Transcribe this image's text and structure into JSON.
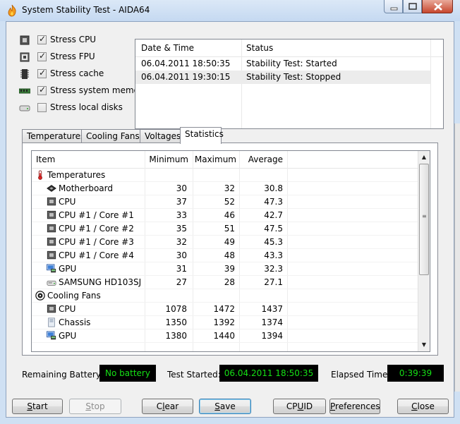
{
  "window": {
    "title": "System Stability Test - AIDA64"
  },
  "stress": [
    {
      "label": "Stress CPU",
      "checked": true,
      "icon": "cpu-icon"
    },
    {
      "label": "Stress FPU",
      "checked": true,
      "icon": "fpu-icon"
    },
    {
      "label": "Stress cache",
      "checked": true,
      "icon": "cache-icon"
    },
    {
      "label": "Stress system memory",
      "checked": true,
      "icon": "memory-icon"
    },
    {
      "label": "Stress local disks",
      "checked": false,
      "icon": "disk-icon"
    }
  ],
  "log": {
    "columns": [
      "Date & Time",
      "Status"
    ],
    "rows": [
      {
        "datetime": "06.04.2011 18:50:35",
        "status": "Stability Test: Started"
      },
      {
        "datetime": "06.04.2011 19:30:15",
        "status": "Stability Test: Stopped"
      }
    ]
  },
  "tabs": [
    "Temperatures",
    "Cooling Fans",
    "Voltages",
    "Statistics"
  ],
  "active_tab": "Statistics",
  "stats": {
    "columns": {
      "item": "Item",
      "min": "Minimum",
      "max": "Maximum",
      "avg": "Average"
    },
    "rows": [
      {
        "kind": "group",
        "label": "Temperatures",
        "icon": "thermometer-icon"
      },
      {
        "kind": "item",
        "label": "Motherboard",
        "icon": "motherboard-icon",
        "min": "30",
        "max": "32",
        "avg": "30.8"
      },
      {
        "kind": "item",
        "label": "CPU",
        "icon": "cpu-chip-icon",
        "min": "37",
        "max": "52",
        "avg": "47.3"
      },
      {
        "kind": "item",
        "label": "CPU #1 / Core #1",
        "icon": "cpu-chip-icon",
        "min": "33",
        "max": "46",
        "avg": "42.7"
      },
      {
        "kind": "item",
        "label": "CPU #1 / Core #2",
        "icon": "cpu-chip-icon",
        "min": "35",
        "max": "51",
        "avg": "47.5"
      },
      {
        "kind": "item",
        "label": "CPU #1 / Core #3",
        "icon": "cpu-chip-icon",
        "min": "32",
        "max": "49",
        "avg": "45.3"
      },
      {
        "kind": "item",
        "label": "CPU #1 / Core #4",
        "icon": "cpu-chip-icon",
        "min": "30",
        "max": "48",
        "avg": "43.3"
      },
      {
        "kind": "item",
        "label": "GPU",
        "icon": "gpu-icon",
        "min": "31",
        "max": "39",
        "avg": "32.3"
      },
      {
        "kind": "item",
        "label": "SAMSUNG HD103SJ",
        "icon": "hard-disk-icon",
        "min": "27",
        "max": "28",
        "avg": "27.1"
      },
      {
        "kind": "group",
        "label": "Cooling Fans",
        "icon": "fan-icon"
      },
      {
        "kind": "item",
        "label": "CPU",
        "icon": "cpu-chip-icon",
        "min": "1078",
        "max": "1472",
        "avg": "1437"
      },
      {
        "kind": "item",
        "label": "Chassis",
        "icon": "chassis-icon",
        "min": "1350",
        "max": "1392",
        "avg": "1374"
      },
      {
        "kind": "item",
        "label": "GPU",
        "icon": "gpu-icon",
        "min": "1380",
        "max": "1440",
        "avg": "1394"
      }
    ]
  },
  "status": {
    "battery_label": "Remaining Battery:",
    "battery_value": "No battery",
    "started_label": "Test Started:",
    "started_value": "06.04.2011 18:50:35",
    "elapsed_label": "Elapsed Time:",
    "elapsed_value": "0:39:39"
  },
  "buttons": [
    {
      "id": "start",
      "label": "Start",
      "accel": 0,
      "enabled": true,
      "default": false
    },
    {
      "id": "stop",
      "label": "Stop",
      "accel": 0,
      "enabled": false,
      "default": false
    },
    {
      "id": "clear",
      "label": "Clear",
      "accel": 1,
      "enabled": true,
      "default": false
    },
    {
      "id": "save",
      "label": "Save",
      "accel": 0,
      "enabled": true,
      "default": true
    },
    {
      "id": "cpuid",
      "label": "CPUID",
      "accel": 2,
      "enabled": true,
      "default": false
    },
    {
      "id": "preferences",
      "label": "Preferences",
      "accel": 0,
      "enabled": true,
      "default": false
    },
    {
      "id": "close",
      "label": "Close",
      "accel": 0,
      "enabled": true,
      "default": false
    }
  ],
  "colors": {
    "status_bg": "#000000",
    "status_text": "#15e015",
    "title_bg": "#c5d9f1"
  }
}
